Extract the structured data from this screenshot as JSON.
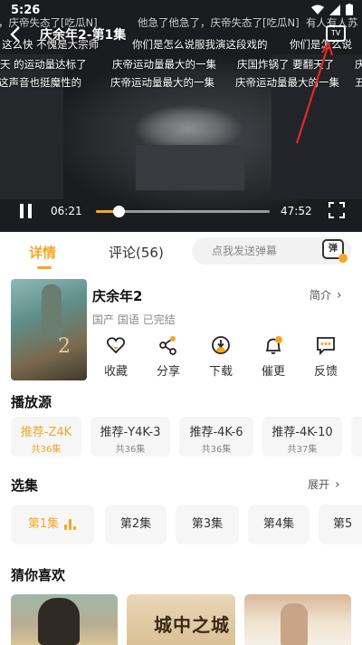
{
  "status_bar": {
    "time": "5:26"
  },
  "player": {
    "title": "庆余年2-第1集",
    "tv_icon_text": "TV",
    "current_time": "06:21",
    "total_time": "47:52",
    "progress": 0.1326
  },
  "danmaku": {
    "row1": [
      "，庆帝失态了[吃瓜N]",
      "他急了他急了，庆帝失态了[吃瓜N]",
      "有人有人苏"
    ],
    "row2": [
      "这么快 不愧是大宗师",
      "你们是怎么说服我演这段戏的",
      "你们是怎么说"
    ],
    "row3": [
      "天 的运动量达标了",
      "庆帝运动量最大的一集",
      "庆国炸锅了 要翻天了",
      "庆"
    ],
    "row4": [
      "这声音也挺魔性的",
      "庆帝运动量最大的一集",
      "庆帝运动量最大的一集",
      "五"
    ]
  },
  "tabs": {
    "details": "详情",
    "comments": "评论(56)"
  },
  "danmaku_input": {
    "placeholder": "点我发送弹幕",
    "toggle_label": "弹"
  },
  "show": {
    "title": "庆余年2",
    "meta": "国产 国语 已完结",
    "intro": "简介",
    "poster_glyph": "2"
  },
  "actions": [
    {
      "label": "收藏",
      "icon": "heart-icon"
    },
    {
      "label": "分享",
      "icon": "share-icon"
    },
    {
      "label": "下载",
      "icon": "download-icon"
    },
    {
      "label": "催更",
      "icon": "bell-icon"
    },
    {
      "label": "反馈",
      "icon": "feedback-icon"
    }
  ],
  "sources": {
    "title": "播放源",
    "items": [
      {
        "name": "推荐-Z4K",
        "count": "共36集",
        "active": true
      },
      {
        "name": "推荐-Y4K-3",
        "count": "共36集",
        "active": false
      },
      {
        "name": "推荐-4K-6",
        "count": "共36集",
        "active": false
      },
      {
        "name": "推荐-4K-10",
        "count": "共37集",
        "active": false
      }
    ]
  },
  "episodes": {
    "title": "选集",
    "expand": "展开",
    "items": [
      "第1集",
      "第2集",
      "第3集",
      "第4集",
      "第5"
    ]
  },
  "recommendations": {
    "title": "猜你喜欢",
    "items": [
      {
        "text": ""
      },
      {
        "text": "城中之城"
      },
      {
        "text": ""
      }
    ]
  },
  "colors": {
    "accent": "#f5a623",
    "annotation": "#e02a2a"
  }
}
